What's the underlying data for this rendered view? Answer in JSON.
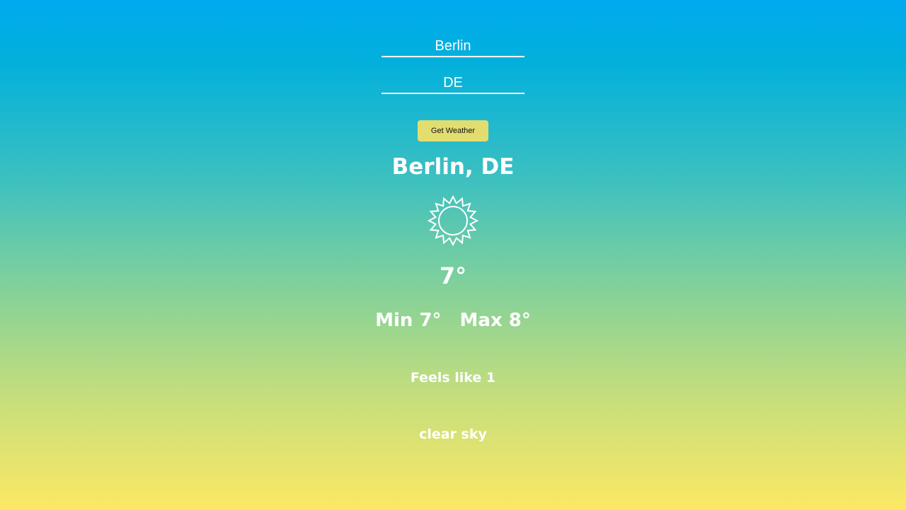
{
  "form": {
    "city_value": "Berlin",
    "country_value": "DE",
    "button_label": "Get Weather"
  },
  "weather": {
    "location": "Berlin, DE",
    "icon": "sun-icon",
    "temperature": "7°",
    "min": "Min 7°",
    "max": "Max 8°",
    "feels_like": "Feels like 1",
    "description": "clear sky"
  },
  "colors": {
    "gradient_top": "#00aaef",
    "gradient_bottom": "#fde864",
    "button_bg": "#e2dd6f",
    "text": "#ffffff"
  }
}
